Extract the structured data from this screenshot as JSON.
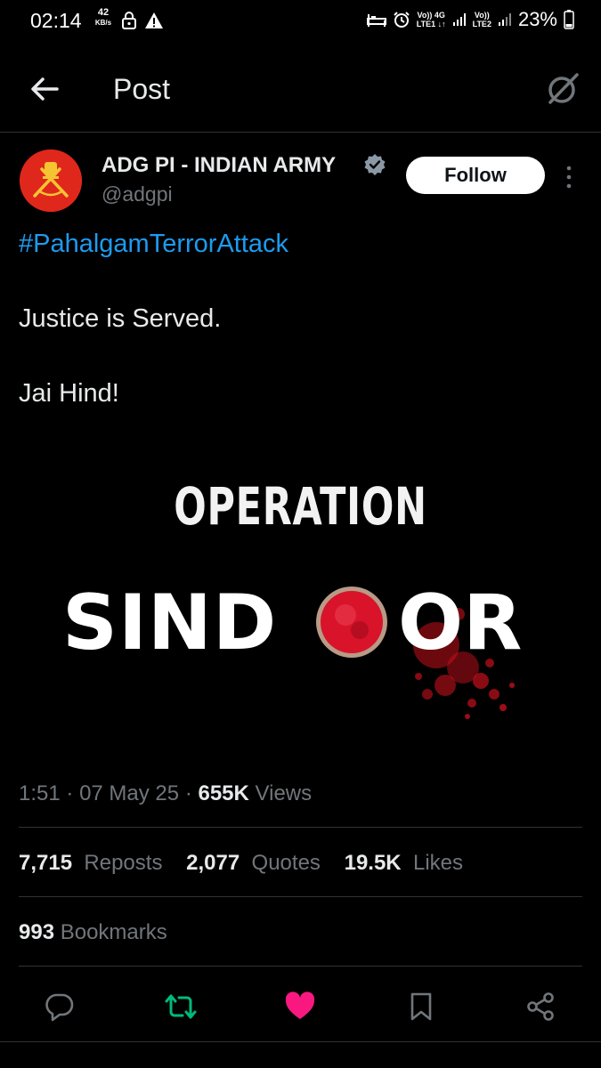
{
  "status_bar": {
    "time": "02:14",
    "net_speed": "42",
    "net_speed_unit": "KB/s",
    "sim1_label": "Vo)) 4G",
    "sim1_sub": "LTE1 ↓↑",
    "sim2_label": "Vo))",
    "sim2_sub": "LTE2",
    "battery": "23%"
  },
  "header": {
    "title": "Post"
  },
  "post": {
    "author_name": "ADG PI - INDIAN ARMY",
    "handle": "@adgpi",
    "follow_label": "Follow",
    "hashtag": "#PahalgamTerrorAttack",
    "line1": "Justice is Served.",
    "line2": "Jai Hind!",
    "image": {
      "word1": "OPERATION",
      "word2_left": "SIND",
      "word2_right": "OR"
    },
    "time": "1:51",
    "date": "07 May 25",
    "views_count": "655K",
    "views_label": "Views",
    "reposts_count": "7,715",
    "reposts_label": "Reposts",
    "quotes_count": "2,077",
    "quotes_label": "Quotes",
    "likes_count": "19.5K",
    "likes_label": "Likes",
    "bookmarks_count": "993",
    "bookmarks_label": "Bookmarks"
  },
  "colors": {
    "link": "#1d9bf0",
    "repost_active": "#00ba7c",
    "like_active": "#f91880",
    "avatar_bg": "#e0271c"
  }
}
